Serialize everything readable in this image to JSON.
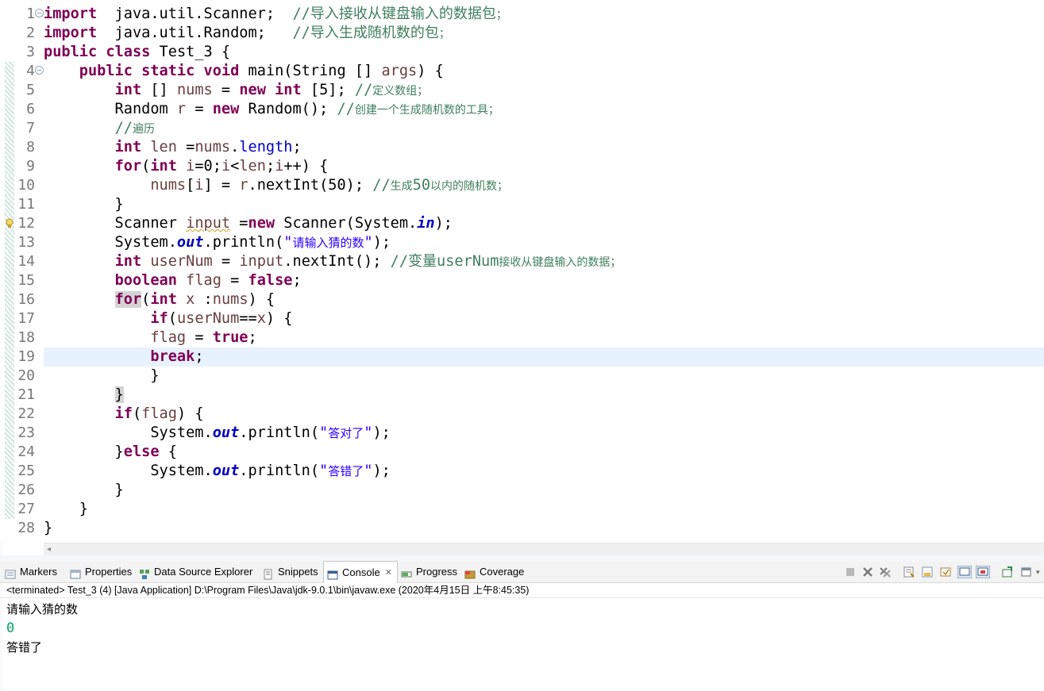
{
  "editor": {
    "current_line": 19,
    "lines": [
      {
        "n": "1",
        "segs": [
          [
            "kw",
            "import"
          ],
          [
            "",
            "  java.util.Scanner;  "
          ],
          [
            "cm",
            "//"
          ],
          [
            "cmcnb",
            "导入接收从键盘输入的数据包"
          ],
          [
            "cmcn",
            "；"
          ]
        ]
      },
      {
        "n": "2",
        "segs": [
          [
            "kw",
            "import"
          ],
          [
            "",
            "  java.util.Random;   "
          ],
          [
            "cm",
            "//"
          ],
          [
            "cmcnb",
            "导入生成随机数的包"
          ],
          [
            "cmcn",
            "；"
          ]
        ]
      },
      {
        "n": "3",
        "segs": [
          [
            "kw",
            "public"
          ],
          [
            "",
            " "
          ],
          [
            "kw",
            "class"
          ],
          [
            "",
            " Test_3 {"
          ]
        ]
      },
      {
        "n": "4",
        "segs": [
          [
            "",
            "    "
          ],
          [
            "kw",
            "public"
          ],
          [
            "",
            " "
          ],
          [
            "kw",
            "static"
          ],
          [
            "",
            " "
          ],
          [
            "kw",
            "void"
          ],
          [
            "",
            " main(String [] "
          ],
          [
            "vr",
            "args"
          ],
          [
            "",
            ") {"
          ]
        ]
      },
      {
        "n": "5",
        "segs": [
          [
            "",
            "        "
          ],
          [
            "kw",
            "int"
          ],
          [
            "",
            " [] "
          ],
          [
            "vr",
            "nums"
          ],
          [
            "",
            " = "
          ],
          [
            "kw",
            "new"
          ],
          [
            "",
            " "
          ],
          [
            "kw",
            "int"
          ],
          [
            "",
            " [5]; "
          ],
          [
            "cm",
            "//"
          ],
          [
            "cmcn",
            "定义数组；"
          ]
        ]
      },
      {
        "n": "6",
        "segs": [
          [
            "",
            "        Random "
          ],
          [
            "vr",
            "r"
          ],
          [
            "",
            " = "
          ],
          [
            "kw",
            "new"
          ],
          [
            "",
            " Random(); "
          ],
          [
            "cm",
            "//"
          ],
          [
            "cmcn",
            "创建一个生成随机数的工具；"
          ]
        ]
      },
      {
        "n": "7",
        "segs": [
          [
            "",
            "        "
          ],
          [
            "cm",
            "//"
          ],
          [
            "cmcn",
            "遍历"
          ]
        ]
      },
      {
        "n": "8",
        "segs": [
          [
            "",
            "        "
          ],
          [
            "kw",
            "int"
          ],
          [
            "",
            " "
          ],
          [
            "vr",
            "len"
          ],
          [
            "",
            " ="
          ],
          [
            "vr",
            "nums"
          ],
          [
            "",
            "."
          ],
          [
            "fd",
            "length"
          ],
          [
            "",
            ";"
          ]
        ]
      },
      {
        "n": "9",
        "segs": [
          [
            "",
            "        "
          ],
          [
            "kw",
            "for"
          ],
          [
            "",
            "("
          ],
          [
            "kw",
            "int"
          ],
          [
            "",
            " "
          ],
          [
            "vr",
            "i"
          ],
          [
            "",
            "=0;"
          ],
          [
            "vr",
            "i"
          ],
          [
            "",
            "<"
          ],
          [
            "vr",
            "len"
          ],
          [
            "",
            ";"
          ],
          [
            "vr",
            "i"
          ],
          [
            "",
            "++) {"
          ]
        ]
      },
      {
        "n": "10",
        "segs": [
          [
            "",
            "            "
          ],
          [
            "vr",
            "nums"
          ],
          [
            "",
            "["
          ],
          [
            "vr",
            "i"
          ],
          [
            "",
            "] = "
          ],
          [
            "vr",
            "r"
          ],
          [
            "",
            ".nextInt(50); "
          ],
          [
            "cm",
            "//"
          ],
          [
            "cmcn",
            "生成"
          ],
          [
            "cm",
            "50"
          ],
          [
            "cmcn",
            "以内的随机数；"
          ]
        ]
      },
      {
        "n": "11",
        "segs": [
          [
            "",
            "        }"
          ]
        ]
      },
      {
        "n": "12",
        "segs": [
          [
            "",
            "        Scanner "
          ],
          [
            "vrsq",
            "input"
          ],
          [
            "",
            " ="
          ],
          [
            "kw",
            "new"
          ],
          [
            "",
            " Scanner(System."
          ],
          [
            "st",
            "in"
          ],
          [
            "",
            ");"
          ]
        ]
      },
      {
        "n": "13",
        "segs": [
          [
            "",
            "        System."
          ],
          [
            "st",
            "out"
          ],
          [
            "",
            ".println("
          ],
          [
            "str",
            "\""
          ],
          [
            "strcn",
            "请输入猜的数"
          ],
          [
            "str",
            "\""
          ],
          [
            "",
            ");"
          ]
        ]
      },
      {
        "n": "14",
        "segs": [
          [
            "",
            "        "
          ],
          [
            "kw",
            "int"
          ],
          [
            "",
            " "
          ],
          [
            "vr",
            "userNum"
          ],
          [
            "",
            " = "
          ],
          [
            "vr",
            "input"
          ],
          [
            "",
            ".nextInt(); "
          ],
          [
            "cm",
            "//"
          ],
          [
            "cmcnb",
            "变量"
          ],
          [
            "cm",
            "userNum"
          ],
          [
            "cmcn",
            "接收从键盘输入的数据；"
          ]
        ]
      },
      {
        "n": "15",
        "segs": [
          [
            "",
            "        "
          ],
          [
            "kw",
            "boolean"
          ],
          [
            "",
            " "
          ],
          [
            "vr",
            "flag"
          ],
          [
            "",
            " = "
          ],
          [
            "kw",
            "false"
          ],
          [
            "",
            ";"
          ]
        ]
      },
      {
        "n": "16",
        "segs": [
          [
            "",
            "        "
          ],
          [
            "kwhl",
            "for"
          ],
          [
            "",
            "("
          ],
          [
            "kw",
            "int"
          ],
          [
            "",
            " "
          ],
          [
            "vr",
            "x"
          ],
          [
            "",
            " :"
          ],
          [
            "vr",
            "nums"
          ],
          [
            "",
            ") {"
          ]
        ]
      },
      {
        "n": "17",
        "segs": [
          [
            "",
            "            "
          ],
          [
            "kw",
            "if"
          ],
          [
            "",
            "("
          ],
          [
            "vr",
            "userNum"
          ],
          [
            "",
            "=="
          ],
          [
            "vr",
            "x"
          ],
          [
            "",
            ") {"
          ]
        ]
      },
      {
        "n": "18",
        "segs": [
          [
            "",
            "            "
          ],
          [
            "vr",
            "flag"
          ],
          [
            "",
            " = "
          ],
          [
            "kw",
            "true"
          ],
          [
            "",
            ";"
          ]
        ]
      },
      {
        "n": "19",
        "segs": [
          [
            "",
            "            "
          ],
          [
            "kw",
            "break"
          ],
          [
            "",
            ";"
          ]
        ]
      },
      {
        "n": "20",
        "segs": [
          [
            "",
            "            }"
          ]
        ]
      },
      {
        "n": "21",
        "segs": [
          [
            "",
            "        "
          ],
          [
            "hl",
            "}"
          ]
        ]
      },
      {
        "n": "22",
        "segs": [
          [
            "",
            "        "
          ],
          [
            "kw",
            "if"
          ],
          [
            "",
            "("
          ],
          [
            "vr",
            "flag"
          ],
          [
            "",
            ") {"
          ]
        ]
      },
      {
        "n": "23",
        "segs": [
          [
            "",
            "            System."
          ],
          [
            "st",
            "out"
          ],
          [
            "",
            ".println("
          ],
          [
            "str",
            "\""
          ],
          [
            "strcn",
            "答对了"
          ],
          [
            "str",
            "\""
          ],
          [
            "",
            ");"
          ]
        ]
      },
      {
        "n": "24",
        "segs": [
          [
            "",
            "        }"
          ],
          [
            "kw",
            "else"
          ],
          [
            "",
            " {"
          ]
        ]
      },
      {
        "n": "25",
        "segs": [
          [
            "",
            "            System."
          ],
          [
            "st",
            "out"
          ],
          [
            "",
            ".println("
          ],
          [
            "str",
            "\""
          ],
          [
            "strcn",
            "答错了"
          ],
          [
            "str",
            "\""
          ],
          [
            "",
            ");"
          ]
        ]
      },
      {
        "n": "26",
        "segs": [
          [
            "",
            "        }"
          ]
        ]
      },
      {
        "n": "27",
        "segs": [
          [
            "",
            "    }"
          ]
        ]
      },
      {
        "n": "28",
        "segs": [
          [
            "",
            "}"
          ]
        ]
      }
    ],
    "fold_lines": [
      "1",
      "4"
    ],
    "warning_line": "12",
    "gutter_bar_from": 4,
    "gutter_bar_to": 27
  },
  "tabs": [
    {
      "label": "Markers",
      "icon": "markers-icon",
      "name": "tab-markers"
    },
    {
      "label": "Properties",
      "icon": "properties-icon",
      "name": "tab-properties"
    },
    {
      "label": "Data Source Explorer",
      "icon": "data-source-icon",
      "name": "tab-data-source-explorer"
    },
    {
      "label": "Snippets",
      "icon": "snippets-icon",
      "name": "tab-snippets"
    },
    {
      "label": "Console",
      "icon": "console-icon",
      "name": "tab-console",
      "active": true,
      "close": "✕"
    },
    {
      "label": "Progress",
      "icon": "progress-icon",
      "name": "tab-progress"
    },
    {
      "label": "Coverage",
      "icon": "coverage-icon",
      "name": "tab-coverage"
    }
  ],
  "toolbar": [
    "terminate-icon",
    "remove-launch-icon",
    "remove-all-icon",
    "scroll-lock-icon",
    "word-wrap-icon",
    "pin-console-icon",
    "show-on-output-icon",
    "show-on-error-icon",
    "new-console-icon",
    "open-console-icon"
  ],
  "console": {
    "status": "<terminated> Test_3 (4) [Java Application] D:\\Program Files\\Java\\jdk-9.0.1\\bin\\javaw.exe (2020年4月15日 上午8:45:35)",
    "lines": [
      {
        "text": "请输入猜的数",
        "kind": "out"
      },
      {
        "text": "0",
        "kind": "in"
      },
      {
        "text": "答错了",
        "kind": "out"
      }
    ]
  },
  "colors": {
    "keyword": "#7f0055",
    "comment": "#3f7f5f",
    "string": "#2a00ff",
    "field": "#0000c0",
    "current_line": "#e8f2fe",
    "console_input": "#00a060"
  }
}
